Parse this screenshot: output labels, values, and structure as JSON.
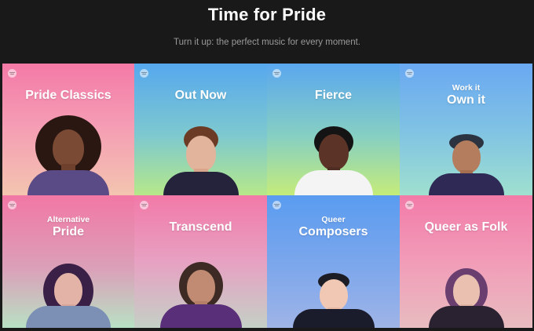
{
  "header": {
    "title": "Time for Pride",
    "subtitle": "Turn it up: the perfect music for every moment."
  },
  "tiles": [
    {
      "small": "",
      "big": "Pride Classics",
      "gradient": "linear-gradient(180deg,#f47aa6 0%,#f59bb4 45%,#f3c5b0 100%)"
    },
    {
      "small": "",
      "big": "Out Now",
      "gradient": "linear-gradient(180deg,#56a8ee 0%,#7ec9cf 55%,#b6e889 100%)"
    },
    {
      "small": "",
      "big": "Fierce",
      "gradient": "linear-gradient(180deg,#5aa7ef 0%,#86cfc3 55%,#c5ec7a 100%)"
    },
    {
      "small": "Work it",
      "big": "Own it",
      "gradient": "linear-gradient(180deg,#6aa8f2 0%,#7fc2e4 50%,#9fe0cf 100%)"
    },
    {
      "small": "Alternative",
      "big": "Pride",
      "gradient": "linear-gradient(180deg,#f277a5 0%,#dba0b8 55%,#b8e1c4 100%)"
    },
    {
      "small": "",
      "big": "Transcend",
      "gradient": "linear-gradient(180deg,#f279a8 0%,#e7a1c2 50%,#c4d0c6 100%)"
    },
    {
      "small": "Queer",
      "big": "Composers",
      "gradient": "linear-gradient(180deg,#5a9cf0 0%,#7aa6ec 50%,#9fb4e7 100%)"
    },
    {
      "small": "",
      "big": "Queer as Folk",
      "gradient": "linear-gradient(180deg,#f27ba8 0%,#f29cb8 50%,#e8bcc0 100%)"
    }
  ],
  "colors": {
    "background": "#191919",
    "title": "#ffffff",
    "subtitle": "#9a9a9a"
  },
  "icons": {
    "tile_logo": "spotify-logo-icon"
  }
}
